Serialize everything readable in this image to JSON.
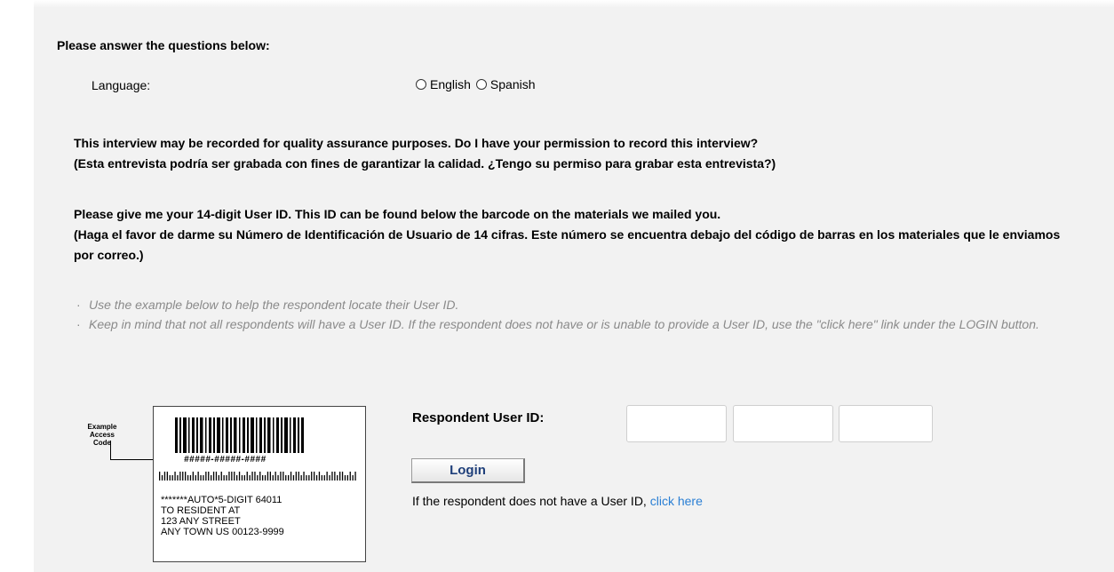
{
  "heading": "Please answer the questions below:",
  "language": {
    "label": "Language:",
    "options": [
      "English",
      "Spanish"
    ],
    "selected": null
  },
  "permission": {
    "english": "This interview may be recorded for quality assurance purposes. Do I have your permission to record this interview?",
    "spanish": "(Esta entrevista podría ser grabada con fines de garantizar la calidad. ¿Tengo su permiso para grabar esta entrevista?)"
  },
  "user_id_prompt": {
    "english": "Please give me your 14-digit User ID. This ID can be found below the barcode on the materials we mailed you.",
    "spanish": "(Haga el favor de darme su Número de Identificación de Usuario de 14 cifras. Este número se encuentra debajo del código de barras en los materiales que le enviamos por correo.)"
  },
  "notes": [
    "Use the example below to help the respondent locate their User ID.",
    "Keep in mind that not all respondents will have a User ID. If the respondent does not have or is unable to provide a User ID, use the \"click here\" link under the LOGIN button."
  ],
  "example": {
    "label_line1": "Example",
    "label_line2": "Access Code",
    "code_mask": "#####-#####-####",
    "address": [
      "*******AUTO*5-DIGIT 64011",
      "TO RESIDENT AT",
      "123 ANY STREET",
      "ANY TOWN US 00123-9999"
    ]
  },
  "login_form": {
    "label": "Respondent User ID:",
    "fields": [
      "",
      "",
      ""
    ],
    "login_label": "Login",
    "no_id_text": "If the respondent does not have a User ID, ",
    "click_here": "click here"
  }
}
